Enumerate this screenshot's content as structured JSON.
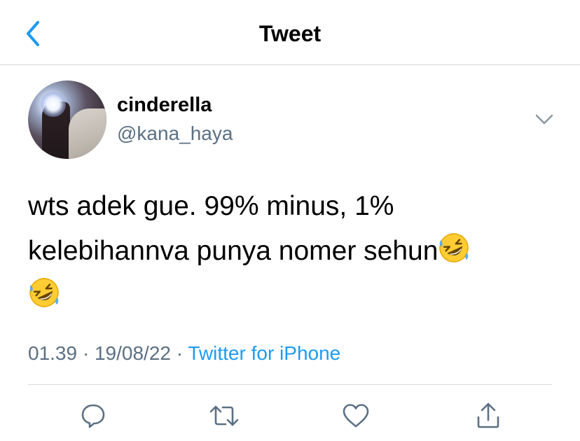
{
  "header": {
    "title": "Tweet",
    "back_icon": "chevron-left-icon",
    "accent_color": "#1d9bf0"
  },
  "author": {
    "display_name": "cinderella",
    "handle": "@kana_haya"
  },
  "tweet": {
    "line1": "wts adek gue. 99% minus, 1%",
    "line2": "kelebihannva punya nomer sehun",
    "emoji": "rolling-on-the-floor-laughing"
  },
  "meta": {
    "time": "01.39",
    "separator": "·",
    "date": "19/08/22",
    "source": "Twitter for iPhone"
  },
  "actions": [
    {
      "icon": "reply-icon"
    },
    {
      "icon": "retweet-icon"
    },
    {
      "icon": "like-icon"
    },
    {
      "icon": "share-icon"
    }
  ]
}
